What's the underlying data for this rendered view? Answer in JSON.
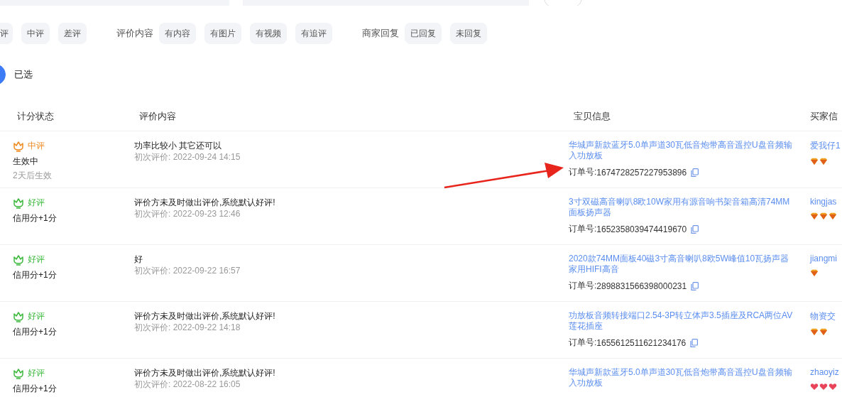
{
  "filters": [
    {
      "chips": [
        "评",
        "中评",
        "差评"
      ]
    },
    {
      "label": "评价内容",
      "chips": [
        "有内容",
        "有图片",
        "有视频",
        "有追评"
      ]
    },
    {
      "label": "商家回复",
      "chips": [
        "已回复",
        "未回复"
      ]
    }
  ],
  "selection": {
    "label": "已选",
    "checked": true
  },
  "table": {
    "columns": [
      "计分状态",
      "评价内容",
      "宝贝信息",
      "买家信"
    ],
    "rows": [
      {
        "rating": {
          "kind": "medium",
          "label": "中评"
        },
        "status": "生效中",
        "status_note": "2天后生效",
        "comment": "功率比较小 其它还可以",
        "first_review": "初次评价: 2022-09-24 14:15",
        "product": "华城声新款蓝牙5.0单声道30瓦低音炮带高音遥控U盘音频输入功放板",
        "order_label": "订单号:",
        "order_no": "1674728257227953896",
        "buyer": "爱我仔1",
        "badges": [
          {
            "kind": "diamond"
          },
          {
            "kind": "diamond"
          }
        ]
      },
      {
        "rating": {
          "kind": "good",
          "label": "好评"
        },
        "status": "信用分+1分",
        "comment": "评价方未及时做出评价,系统默认好评!",
        "first_review": "初次评价: 2022-09-23 12:46",
        "product": "3寸双磁高音喇叭8欧10W家用有源音响书架音箱高清74MM面板扬声器",
        "order_label": "订单号:",
        "order_no": "1652358039474419670",
        "buyer": "kingjas",
        "badges": [
          {
            "kind": "diamond"
          },
          {
            "kind": "diamond"
          },
          {
            "kind": "diamond"
          }
        ]
      },
      {
        "rating": {
          "kind": "good",
          "label": "好评"
        },
        "status": "信用分+1分",
        "comment": "好",
        "first_review": "初次评价: 2022-09-22 16:57",
        "product": "2020款74MM面板40磁3寸高音喇叭8欧5W峰值10瓦扬声器家用HIFI高音",
        "order_label": "订单号:",
        "order_no": "2898831566398000231",
        "buyer": "jiangmi",
        "badges": [
          {
            "kind": "diamond"
          }
        ]
      },
      {
        "rating": {
          "kind": "good",
          "label": "好评"
        },
        "status": "信用分+1分",
        "comment": "评价方未及时做出评价,系统默认好评!",
        "first_review": "初次评价: 2022-09-22 14:18",
        "product": "功放板音频转接端口2.54-3P转立体声3.5插座及RCA两位AV莲花插座",
        "order_label": "订单号:",
        "order_no": "1655612511621234176",
        "buyer": "物资交",
        "badges": [
          {
            "kind": "diamond"
          },
          {
            "kind": "diamond"
          }
        ]
      },
      {
        "rating": {
          "kind": "good",
          "label": "好评"
        },
        "status": "信用分+1分",
        "comment": "评价方未及时做出评价,系统默认好评!",
        "first_review": "初次评价: 2022-08-22 16:05",
        "product": "华城声新款蓝牙5.0单声道30瓦低音炮带高音遥控U盘音频输入功放板",
        "buyer": "zhaoyiz",
        "badges": [
          {
            "kind": "heart"
          },
          {
            "kind": "heart"
          },
          {
            "kind": "heart"
          }
        ]
      }
    ]
  }
}
